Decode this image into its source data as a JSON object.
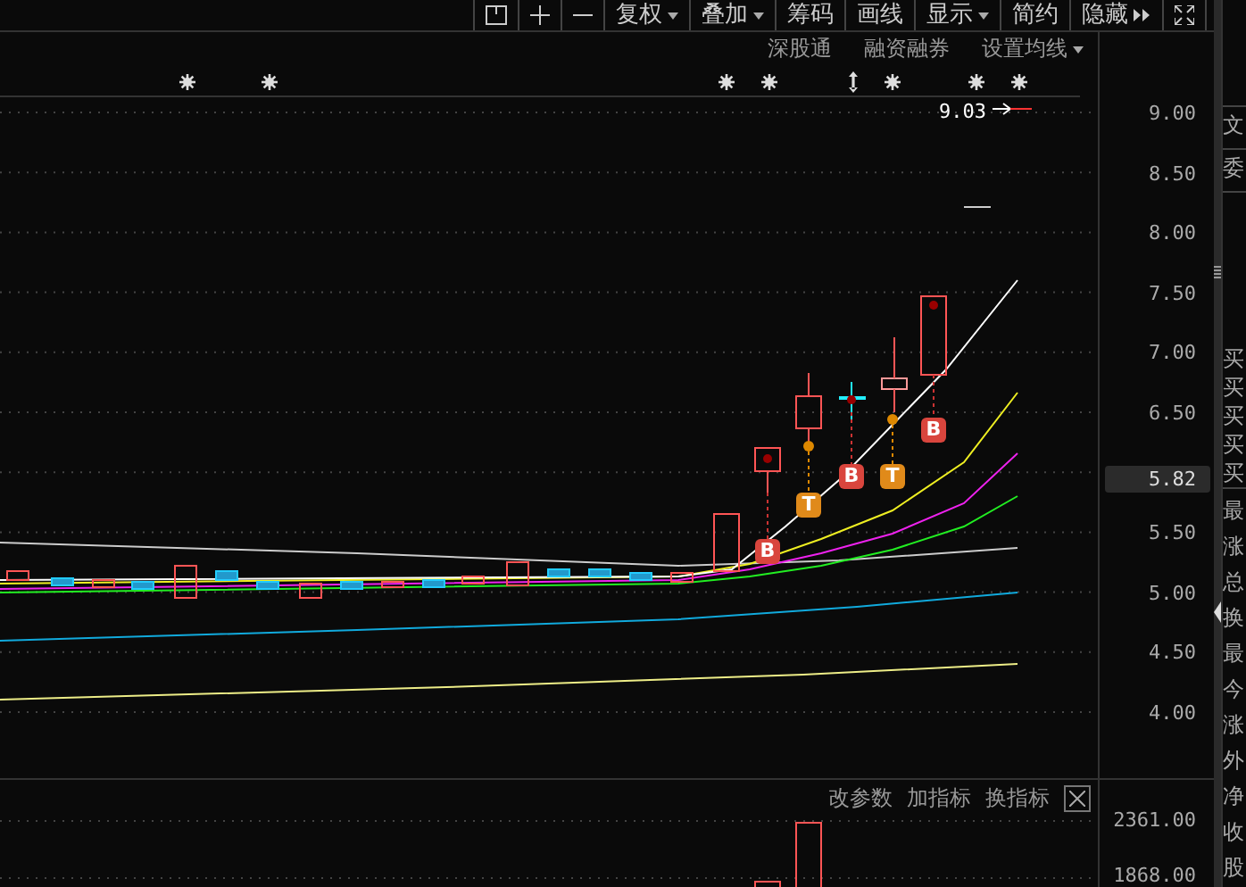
{
  "toolbar": {
    "buttons": [
      {
        "label": "复权",
        "dropdown": true
      },
      {
        "label": "叠加",
        "dropdown": true
      },
      {
        "label": "筹码",
        "dropdown": false
      },
      {
        "label": "画线",
        "dropdown": false
      },
      {
        "label": "显示",
        "dropdown": true
      },
      {
        "label": "简约",
        "dropdown": false
      }
    ],
    "hide_button": "隐藏"
  },
  "chart_header": {
    "links": [
      "深股通",
      "融资融券"
    ],
    "ma_setting": {
      "label": "设置均线",
      "dropdown": true
    }
  },
  "price_marker": "9.03",
  "price_axis": {
    "ticks": [
      "9.00",
      "8.50",
      "8.00",
      "7.50",
      "7.00",
      "6.50",
      "5.50",
      "5.00",
      "4.50",
      "4.00"
    ],
    "current": "5.82"
  },
  "signals": [
    {
      "label": "B",
      "kind": "buy"
    },
    {
      "label": "T",
      "kind": "t"
    },
    {
      "label": "B",
      "kind": "buy"
    },
    {
      "label": "T",
      "kind": "t"
    },
    {
      "label": "B",
      "kind": "buy"
    }
  ],
  "indicator_toolbar": {
    "buttons": [
      "改参数",
      "加指标",
      "换指标"
    ]
  },
  "volume_axis": [
    "2361.00",
    "1868.00"
  ],
  "side_panel": {
    "top": [
      "文",
      "委"
    ],
    "quotes": [
      "买",
      "买",
      "买",
      "买",
      "买"
    ],
    "stats": [
      "最",
      "涨",
      "总",
      "换",
      "最",
      "今",
      "涨",
      "外",
      "净",
      "收",
      "股"
    ]
  }
}
